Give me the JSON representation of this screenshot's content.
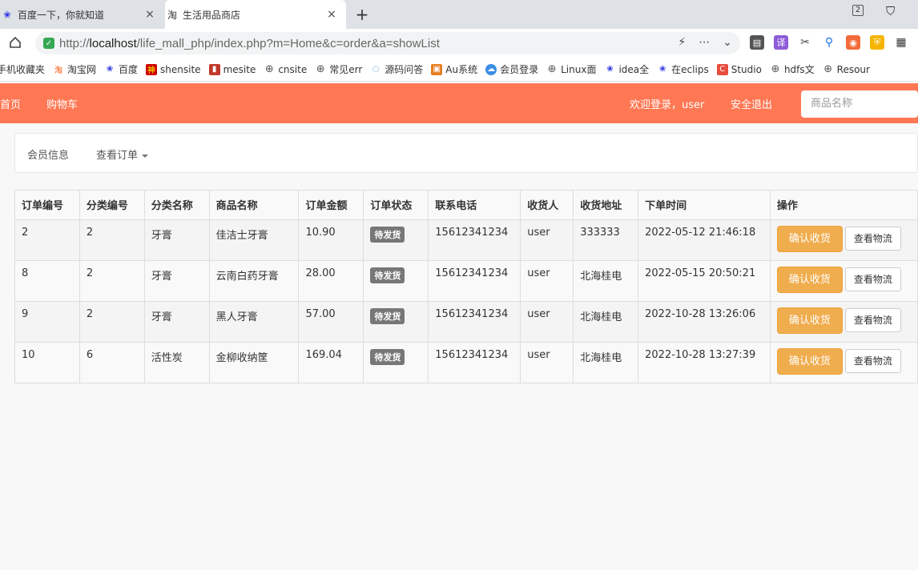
{
  "browser": {
    "tabs": [
      {
        "label": "百度一下，你就知道",
        "close": "×"
      },
      {
        "label": "生活用品商店",
        "close": "×"
      }
    ],
    "new_tab": "+",
    "tab_count": "2",
    "url_prefix": "http://",
    "url_host": "localhost",
    "url_path": "/life_mall_php/index.php?m=Home&c=order&a=showList",
    "bookmarks": [
      "手机收藏夹",
      "淘宝网",
      "百度",
      "shensite",
      "mesite",
      "cnsite",
      "常见err",
      "源码问答",
      "Au系统",
      "会员登录",
      "Linux面",
      "idea全",
      "在eclips",
      "Studio",
      "hdfs文",
      "Resour"
    ]
  },
  "header": {
    "nav": {
      "home": "首页",
      "cart": "购物车"
    },
    "welcome": "欢迎登录，user",
    "logout": "安全退出",
    "search_placeholder": "商品名称"
  },
  "subnav": {
    "member_info": "会员信息",
    "view_orders": "查看订单"
  },
  "table": {
    "headers": [
      "订单编号",
      "分类编号",
      "分类名称",
      "商品名称",
      "订单金额",
      "订单状态",
      "联系电话",
      "收货人",
      "收货地址",
      "下单时间",
      "操作"
    ],
    "rows": [
      {
        "id": "2",
        "cat_id": "2",
        "cat_name": "牙膏",
        "product": "佳洁士牙膏",
        "amount": "10.90",
        "status": "待发货",
        "phone": "15612341234",
        "receiver": "user",
        "address": "333333",
        "time": "2022-05-12 21:46:18"
      },
      {
        "id": "8",
        "cat_id": "2",
        "cat_name": "牙膏",
        "product": "云南白药牙膏",
        "amount": "28.00",
        "status": "待发货",
        "phone": "15612341234",
        "receiver": "user",
        "address": "北海桂电",
        "time": "2022-05-15 20:50:21"
      },
      {
        "id": "9",
        "cat_id": "2",
        "cat_name": "牙膏",
        "product": "黑人牙膏",
        "amount": "57.00",
        "status": "待发货",
        "phone": "15612341234",
        "receiver": "user",
        "address": "北海桂电",
        "time": "2022-10-28 13:26:06"
      },
      {
        "id": "10",
        "cat_id": "6",
        "cat_name": "活性炭",
        "product": "金柳收纳筐",
        "amount": "169.04",
        "status": "待发货",
        "phone": "15612341234",
        "receiver": "user",
        "address": "北海桂电",
        "time": "2022-10-28 13:27:39"
      }
    ],
    "confirm_label": "确认收货",
    "track_label": "查看物流"
  },
  "colors": {
    "header": "#ff7753",
    "confirm_button": "#f0ad4e",
    "status_badge": "#777777"
  }
}
